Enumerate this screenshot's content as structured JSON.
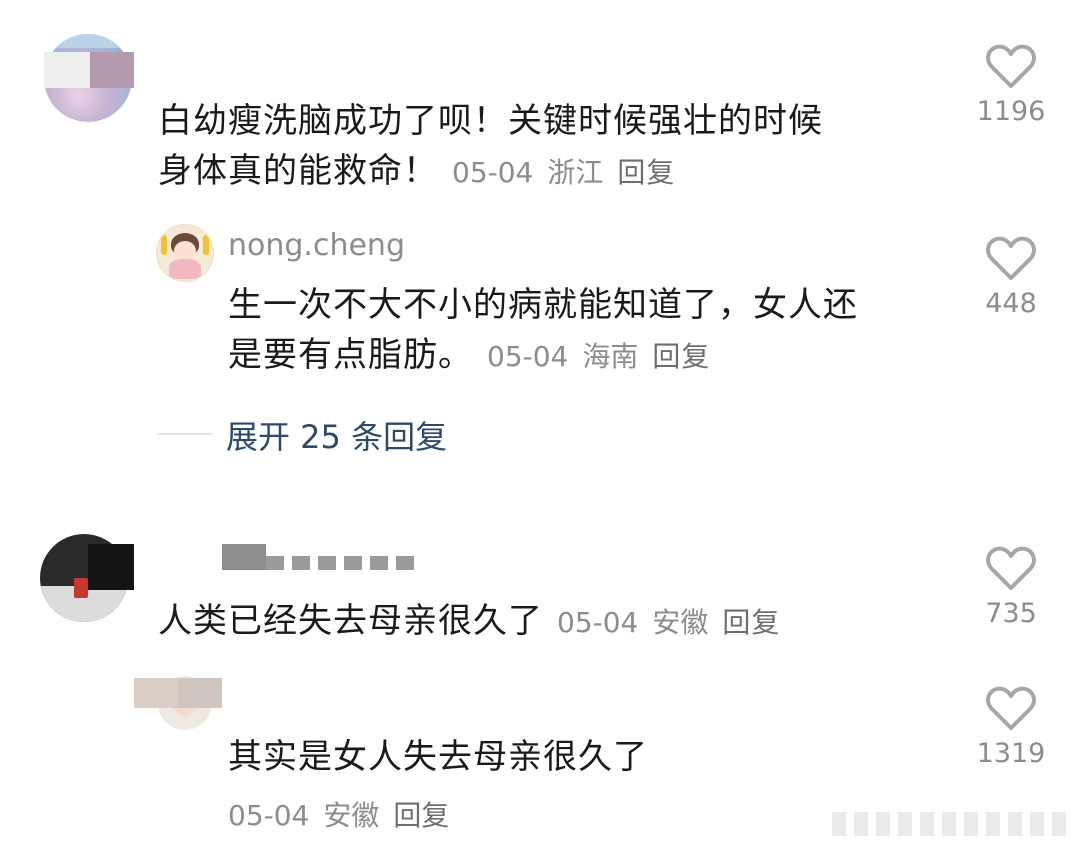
{
  "comments": [
    {
      "text_line1": "白幼瘦洗脑成功了呗！关键时候强壮的时候",
      "text_line2": "身体真的能救命！",
      "date": "05-04",
      "location": "浙江",
      "reply_label": "回复",
      "likes": "1196",
      "replies": [
        {
          "username": "nong.cheng",
          "text_line1": "生一次不大不小的病就能知道了，女人还",
          "text_line2": "是要有点脂肪。",
          "date": "05-04",
          "location": "海南",
          "reply_label": "回复",
          "likes": "448"
        }
      ],
      "expand_label": "展开 25 条回复"
    },
    {
      "text": "人类已经失去母亲很久了",
      "date": "05-04",
      "location": "安徽",
      "reply_label": "回复",
      "likes": "735",
      "replies": [
        {
          "text": "其实是女人失去母亲很久了",
          "date": "05-04",
          "location": "安徽",
          "reply_label": "回复",
          "likes": "1319"
        }
      ]
    }
  ],
  "colors": {
    "text": "#1a1a1a",
    "meta": "#8c8c8c",
    "expand": "#2d4a6b",
    "heart": "#a6a6a6"
  }
}
